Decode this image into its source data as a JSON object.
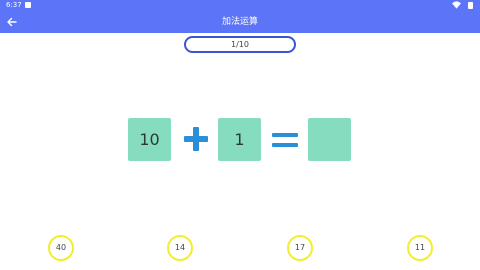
{
  "status_bar": {
    "time": "6:37",
    "notification_icon": "notification-icon",
    "wifi_icon": "wifi-icon",
    "battery_icon": "battery-icon"
  },
  "app_bar": {
    "title": "加法运算",
    "back_icon": "arrow-back-icon"
  },
  "progress": "1/10",
  "equation": {
    "operand_a": "10",
    "operator": "plus",
    "operand_b": "1",
    "equals": "equals",
    "result": ""
  },
  "answers": [
    "40",
    "14",
    "17",
    "11"
  ],
  "colors": {
    "primary": "#5c74f7",
    "pill_border": "#3b55d0",
    "tile": "#86dcbf",
    "operator": "#2a8fd6",
    "answer_ring": "#f1ee2e"
  }
}
